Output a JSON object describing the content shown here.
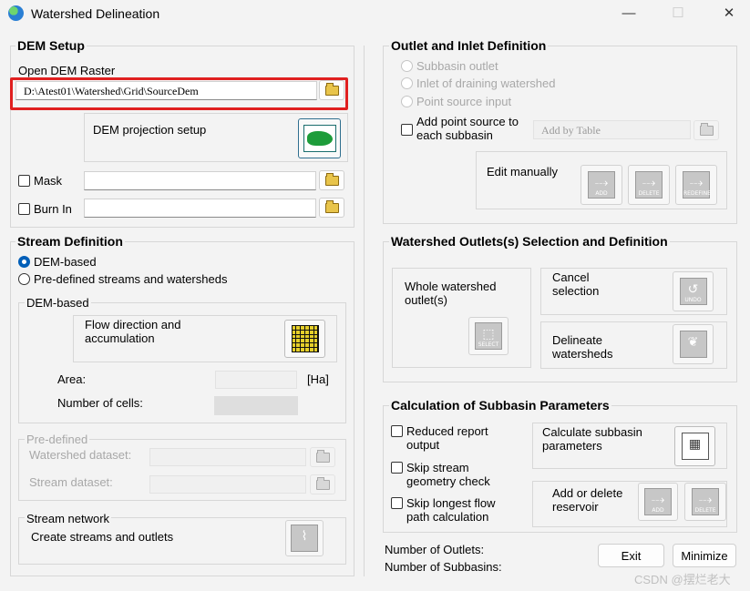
{
  "window": {
    "title": "Watershed Delineation",
    "minimize_glyph": "—",
    "maximize_glyph": "☐",
    "close_glyph": "✕"
  },
  "dem_setup": {
    "title": "DEM Setup",
    "open_dem_label": "Open DEM Raster",
    "dem_path": "D:\\Atest01\\Watershed\\Grid\\SourceDem",
    "projection_label": "DEM projection setup",
    "mask_label": "Mask",
    "mask_value": "",
    "burn_in_label": "Burn In",
    "burn_in_value": ""
  },
  "stream_definition": {
    "title": "Stream Definition",
    "opt_dem_based": "DEM-based",
    "opt_predefined": "Pre-defined streams and watersheds",
    "dem_based_title": "DEM-based",
    "flow_label": "Flow direction and accumulation",
    "area_label": "Area:",
    "area_unit": "[Ha]",
    "area_value": "",
    "cells_label": "Number of cells:",
    "cells_value": "",
    "predefined_title": "Pre-defined",
    "watershed_dataset_label": "Watershed dataset:",
    "stream_dataset_label": "Stream dataset:",
    "network_title": "Stream network",
    "create_label": "Create streams and outlets"
  },
  "outlet": {
    "title": "Outlet and Inlet Definition",
    "opt_subbasin": "Subbasin outlet",
    "opt_inlet": "Inlet of draining watershed",
    "opt_point": "Point source input",
    "add_point_label": "Add point source to each subbasin",
    "add_by_table": "Add by Table",
    "edit_manually": "Edit manually",
    "add_btn_caption": "ADD",
    "delete_btn_caption": "DELETE",
    "redefine_btn_caption": "REDEFINE"
  },
  "selection": {
    "title": "Watershed Outlets(s) Selection and Definition",
    "whole_label": "Whole watershed outlet(s)",
    "select_caption": "SELECT",
    "cancel_label": "Cancel selection",
    "undo_caption": "UNDO",
    "delineate_label": "Delineate watersheds"
  },
  "params": {
    "title": "Calculation of Subbasin Parameters",
    "reduced_label": "Reduced  report output",
    "skip_stream_label": "Skip stream geometry check",
    "skip_longest_label": "Skip longest flow path calculation",
    "calc_label": "Calculate subbasin parameters",
    "reservoir_label": "Add or delete reservoir",
    "add_caption": "ADD",
    "delete_caption": "DELETE"
  },
  "footer": {
    "outlets_label": "Number of Outlets:",
    "outlets_value": "",
    "subbasins_label": "Number of Subbasins:",
    "subbasins_value": "",
    "exit_label": "Exit",
    "minimize_label": "Minimize",
    "watermark": "CSDN @摆烂老大"
  },
  "colors": {
    "highlight": "#e02020",
    "accent": "#005fb8",
    "background": "#f3f3f3"
  }
}
